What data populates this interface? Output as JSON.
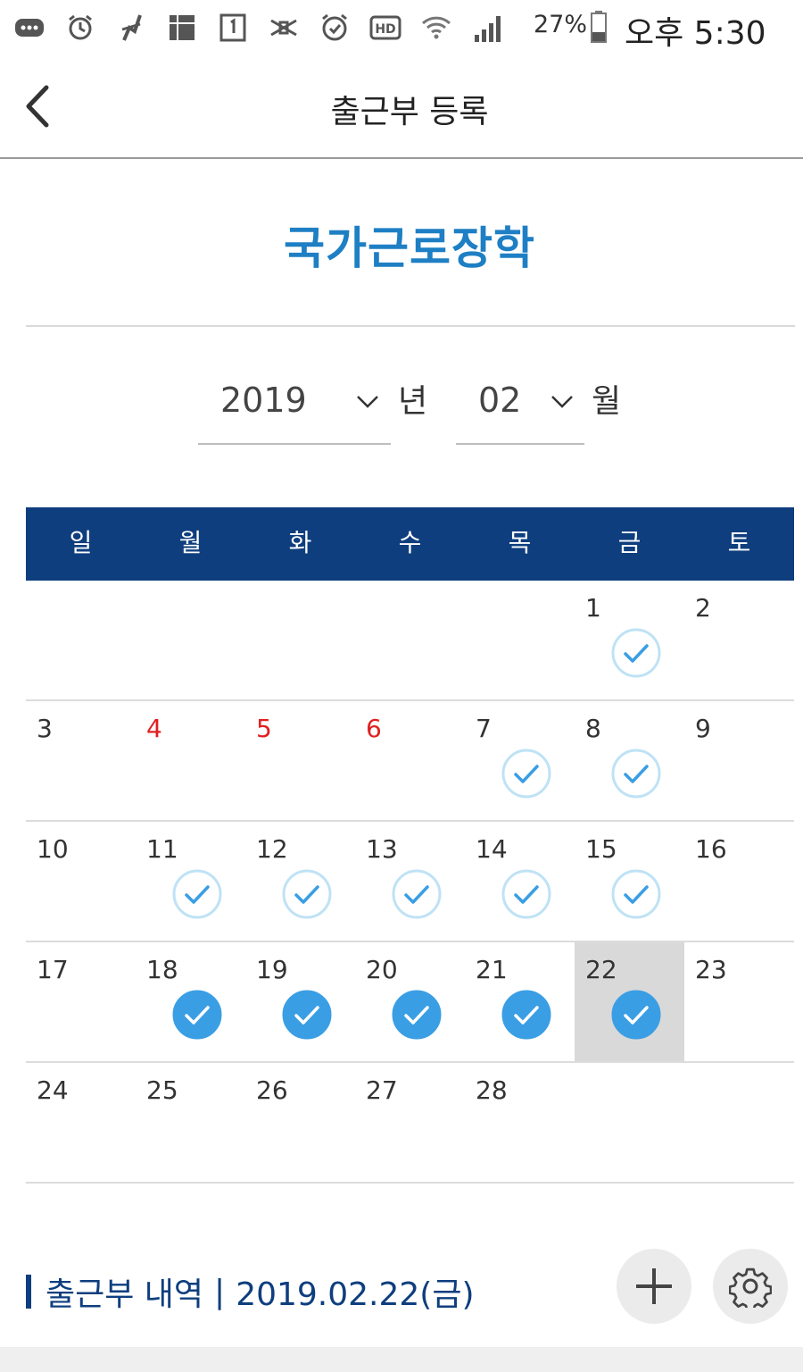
{
  "status_bar": {
    "icons": [
      "message-icon",
      "alarm-icon",
      "app-icon",
      "grid-icon",
      "calendar-icon",
      "mute-icon",
      "alarm-clock-icon",
      "hd-icon",
      "wifi-icon",
      "signal-icon"
    ],
    "battery": "27%",
    "time": "오후 5:30"
  },
  "app_bar": {
    "title": "출근부 등록"
  },
  "program": {
    "title": "국가근로장학"
  },
  "picker": {
    "year": "2019",
    "year_unit": "년",
    "month": "02",
    "month_unit": "월"
  },
  "calendar": {
    "weekdays": [
      "일",
      "월",
      "화",
      "수",
      "목",
      "금",
      "토"
    ],
    "weeks": [
      [
        {
          "d": ""
        },
        {
          "d": ""
        },
        {
          "d": ""
        },
        {
          "d": ""
        },
        {
          "d": ""
        },
        {
          "d": "1",
          "check": "light"
        },
        {
          "d": "2"
        }
      ],
      [
        {
          "d": "3"
        },
        {
          "d": "4",
          "holiday": true
        },
        {
          "d": "5",
          "holiday": true
        },
        {
          "d": "6",
          "holiday": true
        },
        {
          "d": "7",
          "check": "light"
        },
        {
          "d": "8",
          "check": "light"
        },
        {
          "d": "9"
        }
      ],
      [
        {
          "d": "10"
        },
        {
          "d": "11",
          "check": "light"
        },
        {
          "d": "12",
          "check": "light"
        },
        {
          "d": "13",
          "check": "light"
        },
        {
          "d": "14",
          "check": "light"
        },
        {
          "d": "15",
          "check": "light"
        },
        {
          "d": "16"
        }
      ],
      [
        {
          "d": "17"
        },
        {
          "d": "18",
          "check": "filled"
        },
        {
          "d": "19",
          "check": "filled"
        },
        {
          "d": "20",
          "check": "filled"
        },
        {
          "d": "21",
          "check": "filled"
        },
        {
          "d": "22",
          "check": "filled",
          "today": true
        },
        {
          "d": "23"
        }
      ],
      [
        {
          "d": "24"
        },
        {
          "d": "25"
        },
        {
          "d": "26"
        },
        {
          "d": "27"
        },
        {
          "d": "28"
        },
        {
          "d": ""
        },
        {
          "d": ""
        }
      ]
    ]
  },
  "history": {
    "label": "출근부 내역",
    "separator": "|",
    "date": "2019.02.22(금)"
  },
  "colors": {
    "header_navy": "#0e3e7e",
    "title_blue": "#1e7fc4",
    "check_blue": "#3a9ee4",
    "check_light_ring": "#bfe2f5",
    "holiday_red": "#e02020",
    "today_bg": "#d9d9d9"
  },
  "actions": {
    "add_icon": "plus-icon",
    "settings_icon": "gear-icon"
  }
}
